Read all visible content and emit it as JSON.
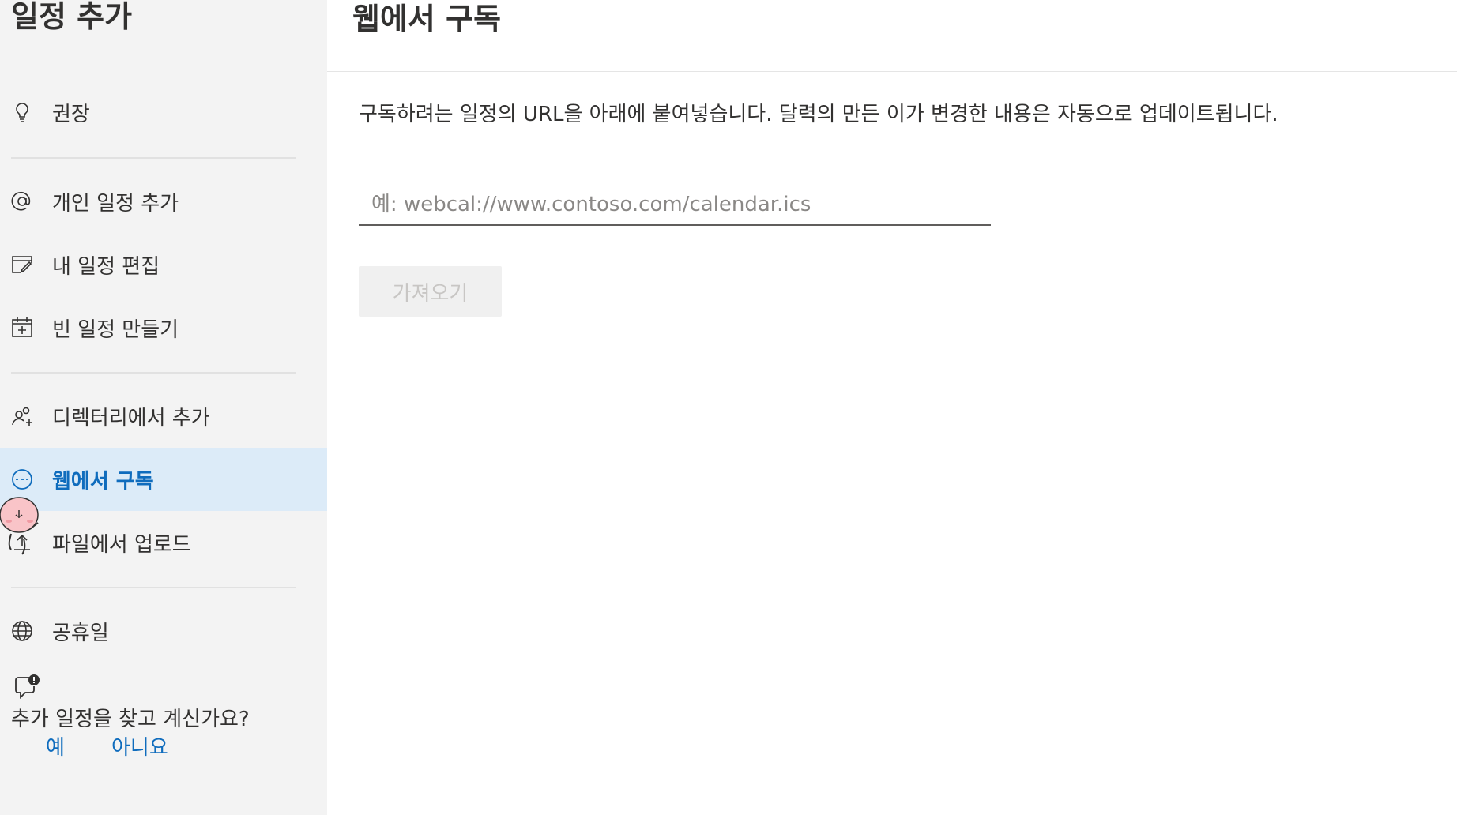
{
  "sidebar": {
    "title": "일정 추가",
    "items": [
      {
        "label": "권장",
        "icon": "lightbulb-icon"
      },
      {
        "label": "개인 일정 추가",
        "icon": "at-sign-icon"
      },
      {
        "label": "내 일정 편집",
        "icon": "calendar-edit-icon"
      },
      {
        "label": "빈 일정 만들기",
        "icon": "calendar-add-icon"
      },
      {
        "label": "디렉터리에서 추가",
        "icon": "people-add-icon"
      },
      {
        "label": "웹에서 구독",
        "icon": "link-circle-icon",
        "selected": true
      },
      {
        "label": "파일에서 업로드",
        "icon": "upload-icon"
      },
      {
        "label": "공휴일",
        "icon": "globe-icon"
      }
    ],
    "feedback": {
      "question": "추가 일정을 찾고 계신가요?",
      "yes": "예",
      "no": "아니요"
    }
  },
  "main": {
    "title": "웹에서 구독",
    "description": "구독하려는 일정의 URL을 아래에 붙여넣습니다. 달력의 만든 이가 변경한 내용은 자동으로 업데이트됩니다.",
    "url_placeholder": "예: webcal://www.contoso.com/calendar.ics",
    "url_value": "",
    "import_label": "가져오기"
  },
  "colors": {
    "sidebar_bg": "#f3f3f3",
    "selected_bg": "#dcebf8",
    "accent": "#0f6cbd",
    "text": "#323130"
  }
}
